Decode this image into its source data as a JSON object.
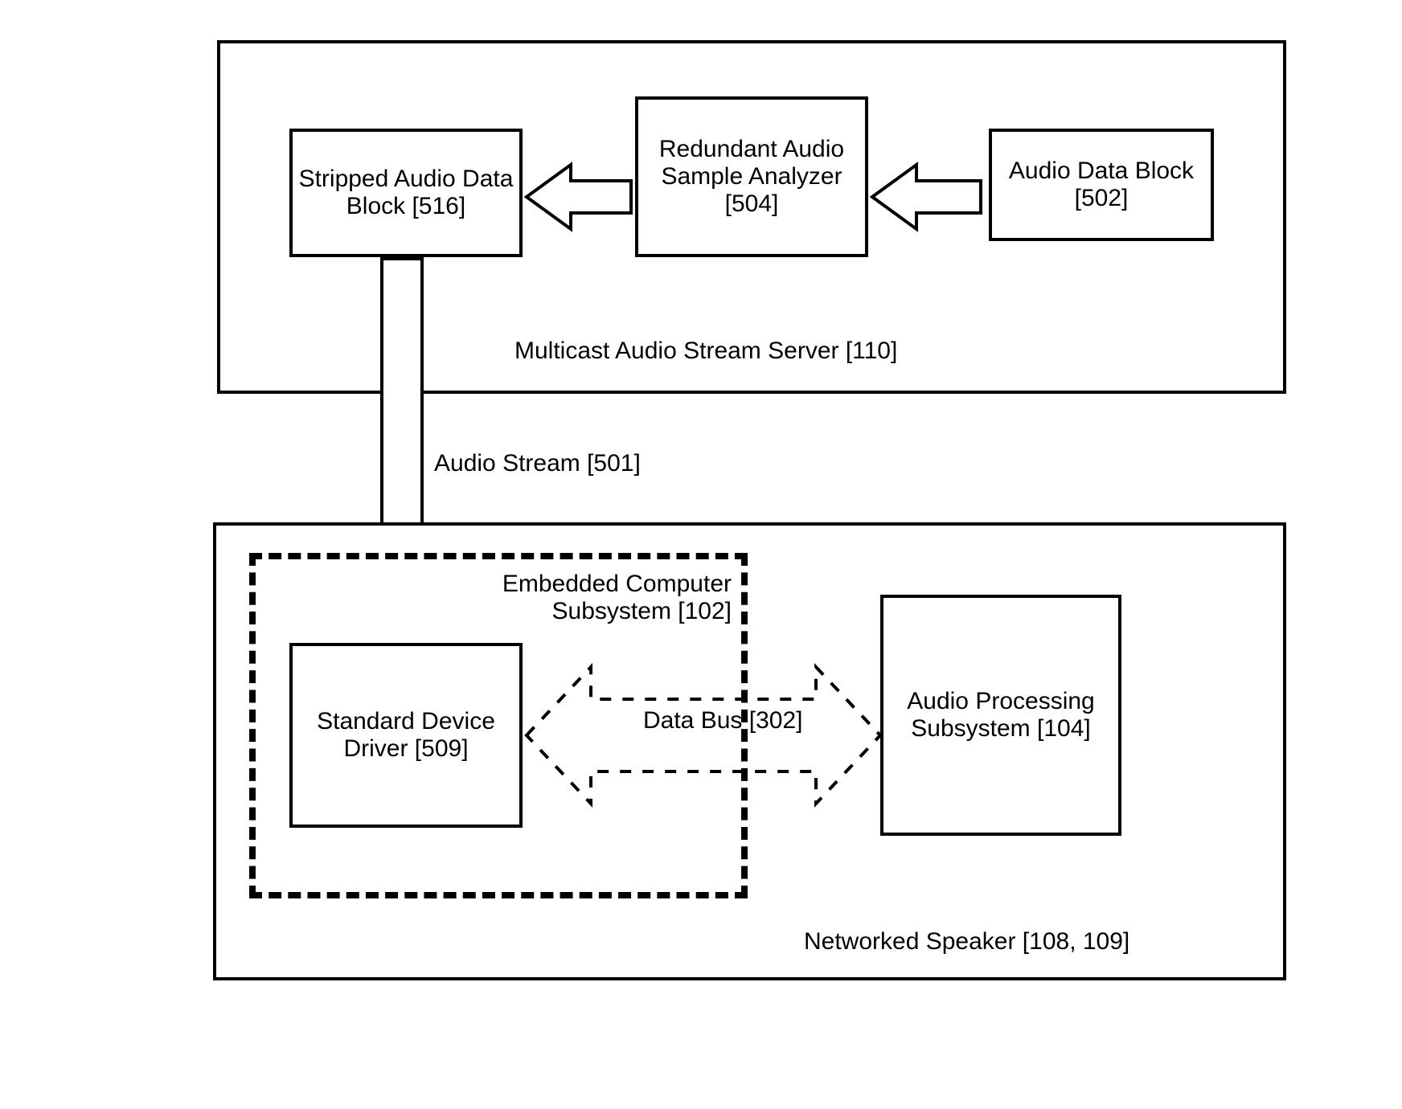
{
  "top_container": {
    "label": "Multicast Audio Stream Server [110]",
    "blocks": {
      "stripped": "Stripped Audio Data Block [516]",
      "analyzer": "Redundant Audio Sample Analyzer [504]",
      "audio_block": "Audio Data Block [502]"
    }
  },
  "stream_label": "Audio Stream [501]",
  "bottom_container": {
    "label": "Networked Speaker [108, 109]",
    "embedded_label_line1": "Embedded Computer",
    "embedded_label_line2": "Subsystem [102]",
    "blocks": {
      "driver": "Standard Device Driver [509]",
      "bus": "Data Bus [302]",
      "audio_proc": "Audio Processing Subsystem [104]"
    }
  }
}
